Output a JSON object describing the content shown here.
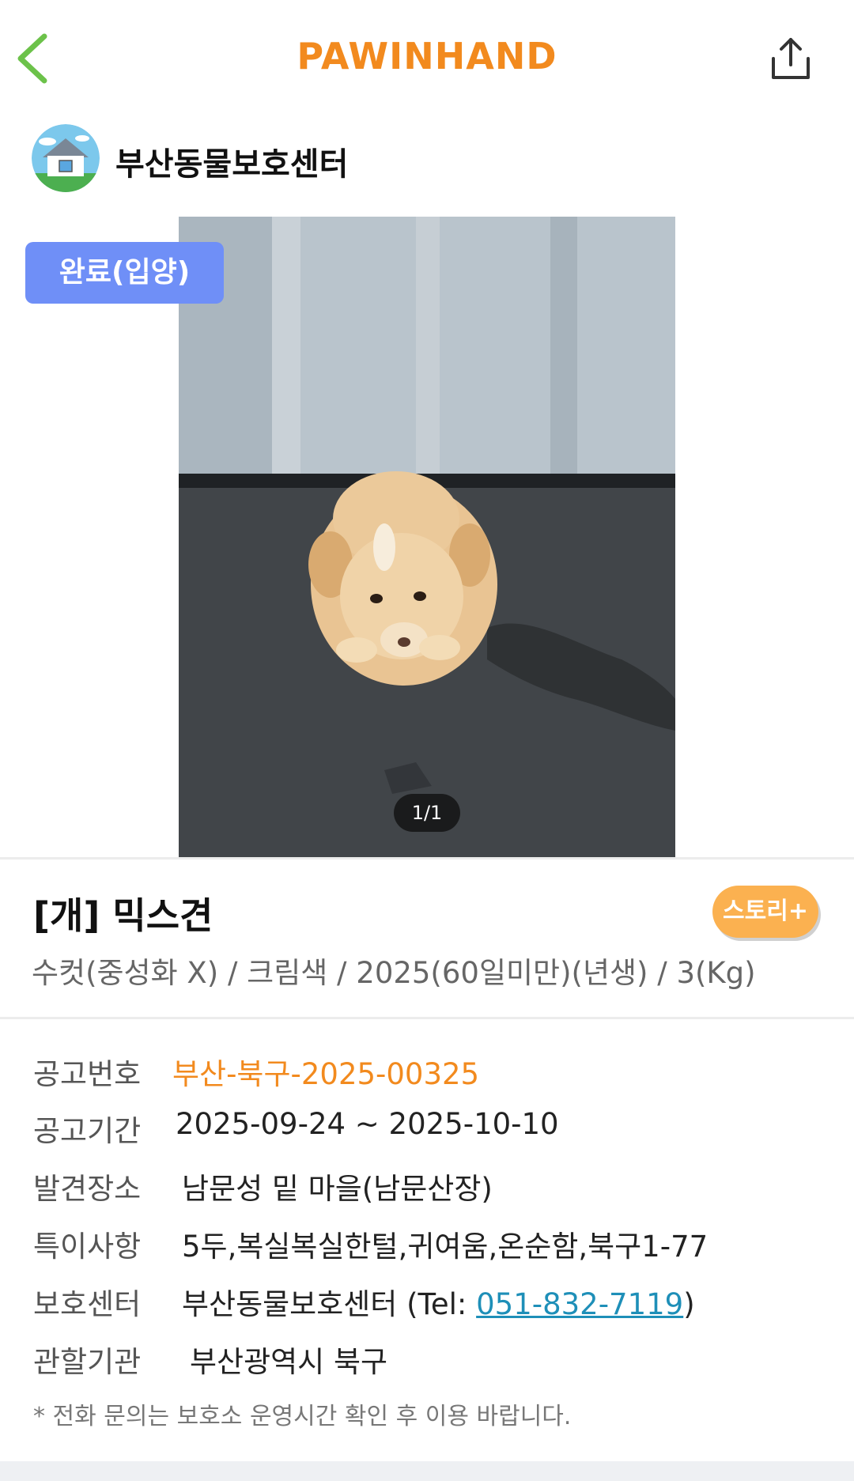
{
  "header": {
    "logo_text": "PAWINHAND",
    "back_icon": "chevron-left-icon",
    "share_icon": "share-icon",
    "accent_color": "#f28a1e",
    "back_color": "#6cc24a"
  },
  "shelter": {
    "name": "부산동물보호센터",
    "avatar_icon": "house-icon"
  },
  "photo": {
    "counter": "1/1",
    "status_badge": "완료(입양)"
  },
  "animal": {
    "title": "[개] 믹스견",
    "story_button": "스토리+",
    "summary": "수컷(중성화 X) / 크림색 / 2025(60일미만)(년생) / 3(Kg)"
  },
  "info": {
    "notice_no": {
      "label": "공고번호",
      "value": "부산-북구-2025-00325"
    },
    "notice_period": {
      "label": "공고기간",
      "value": "2025-09-24 ~ 2025-10-10"
    },
    "found_place": {
      "label": "발견장소",
      "value": "남문성 밑 마을(남문산장)"
    },
    "features": {
      "label": "특이사항",
      "value": "5두,복실복실한털,귀여움,온순함,북구1-77"
    },
    "shelter": {
      "label": "보호센터",
      "value_prefix": "부산동물보호센터 (Tel: ",
      "phone": "051-832-7119",
      "value_suffix": ")"
    },
    "authority": {
      "label": "관할기관",
      "value": "부산광역시 북구"
    }
  },
  "footnote": "* 전화 문의는 보호소 운영시간 확인 후 이용 바랍니다."
}
